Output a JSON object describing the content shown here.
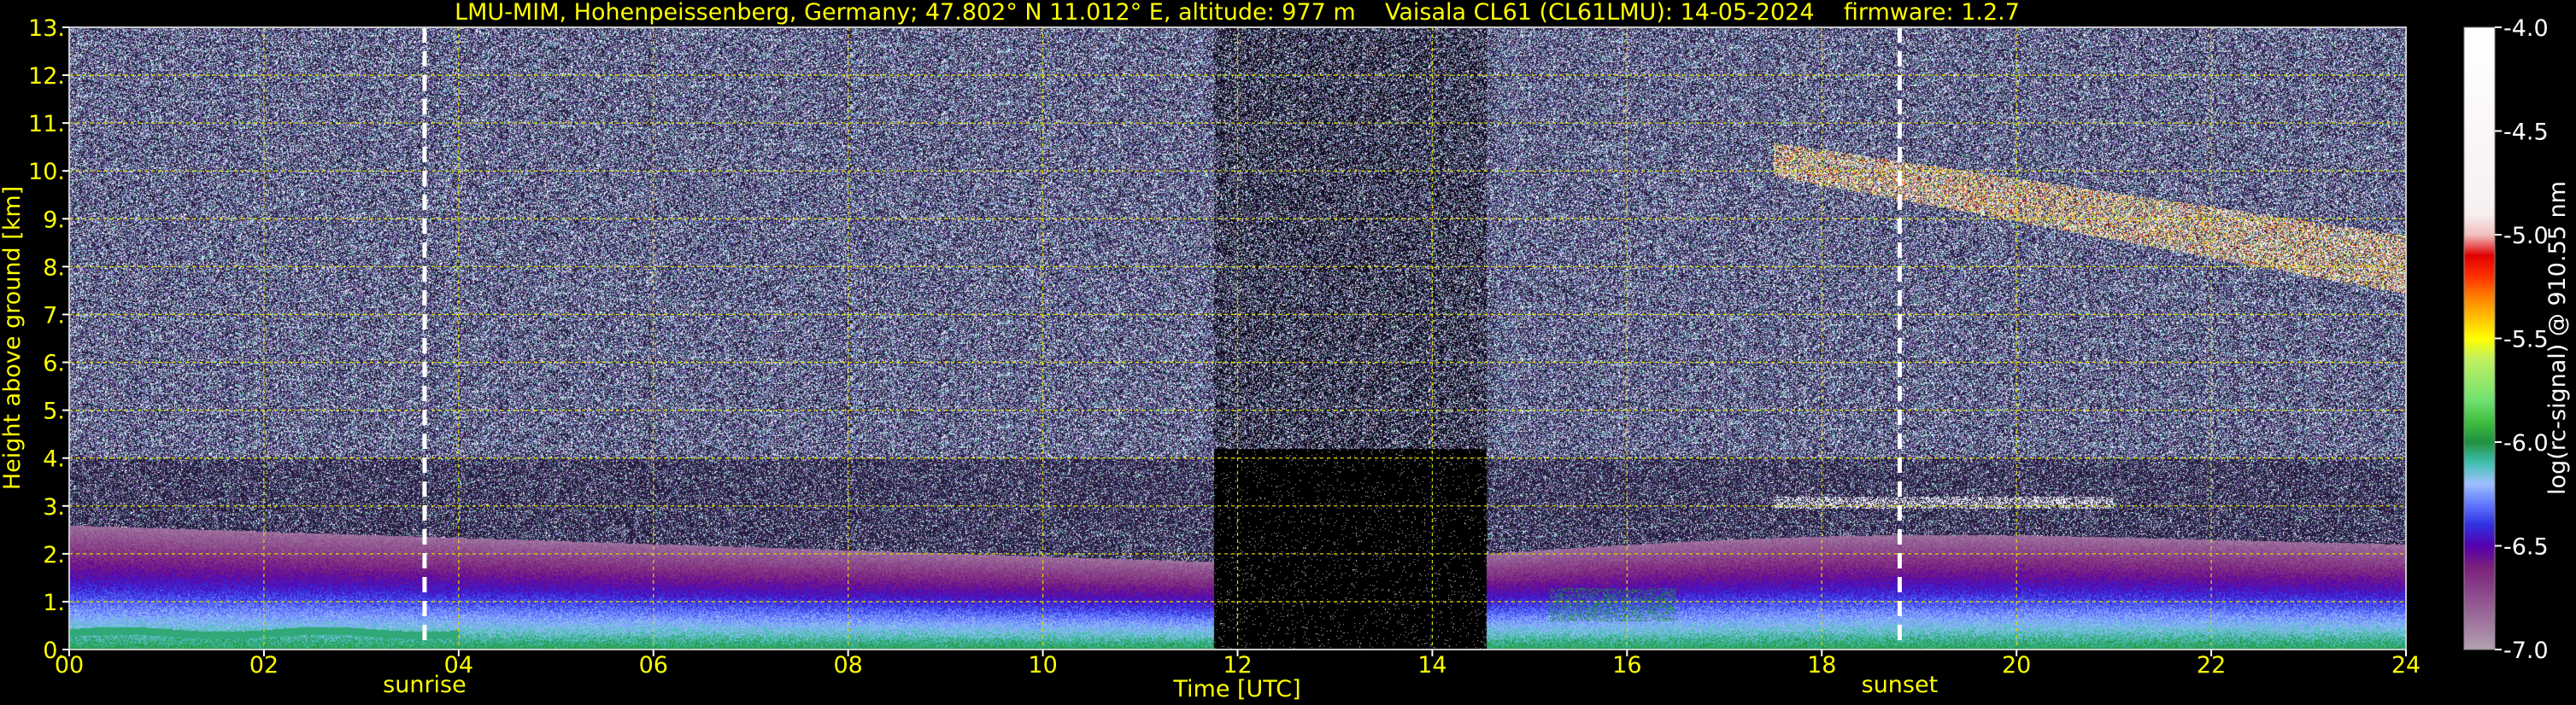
{
  "title": "LMU-MIM, Hohenpeissenberg, Germany; 47.802° N 11.012° E, altitude: 977 m    Vaisala CL61 (CL61LMU): 14-05-2024    firmware: 1.2.7",
  "colors": {
    "background": "#000000",
    "text": "#ffff00",
    "grid": "#d8d800",
    "markers": "#ffffff"
  },
  "chart_data": {
    "type": "heatmap",
    "title": "LMU-MIM, Hohenpeissenberg, Germany; 47.802° N 11.012° E, altitude: 977 m    Vaisala CL61 (CL61LMU): 14-05-2024    firmware: 1.2.7",
    "xlabel": "Time [UTC]",
    "ylabel": "Height above ground [km]",
    "xlim": [
      0,
      24
    ],
    "ylim": [
      0,
      13
    ],
    "x_ticks": [
      0,
      2,
      4,
      6,
      8,
      10,
      12,
      14,
      16,
      18,
      20,
      22,
      24
    ],
    "x_tick_labels": [
      "00",
      "02",
      "04",
      "06",
      "08",
      "10",
      "12",
      "14",
      "16",
      "18",
      "20",
      "22",
      "24"
    ],
    "y_ticks": [
      0,
      1,
      2,
      3,
      4,
      5,
      6,
      7,
      8,
      9,
      10,
      11,
      12,
      13
    ],
    "y_tick_labels": [
      "0.",
      "1.",
      "2.",
      "3.",
      "4.",
      "5.",
      "6.",
      "7.",
      "8.",
      "9.",
      "10.",
      "11.",
      "12.",
      "13."
    ],
    "grid": true,
    "vertical_markers": [
      {
        "label": "sunrise",
        "x": 3.65
      },
      {
        "label": "sunset",
        "x": 18.8
      }
    ],
    "colorbar": {
      "label": "log(rc-signal) @ 910.55 nm",
      "range": [
        -7.0,
        -4.0
      ],
      "ticks": [
        -4.0,
        -4.5,
        -5.0,
        -5.5,
        -6.0,
        -6.5,
        -7.0
      ],
      "tick_labels": [
        "-4.0",
        "-4.5",
        "-5.0",
        "-5.5",
        "-6.0",
        "-6.5",
        "-7.0"
      ],
      "stops": [
        {
          "value": -7.0,
          "color": "#b3a1b3"
        },
        {
          "value": -6.8,
          "color": "#955f95"
        },
        {
          "value": -6.6,
          "color": "#7a1f7a"
        },
        {
          "value": -6.5,
          "color": "#5500b0"
        },
        {
          "value": -6.4,
          "color": "#3030e0"
        },
        {
          "value": -6.3,
          "color": "#6078ff"
        },
        {
          "value": -6.2,
          "color": "#9fc0ff"
        },
        {
          "value": -6.1,
          "color": "#40c0b0"
        },
        {
          "value": -6.0,
          "color": "#209040"
        },
        {
          "value": -5.9,
          "color": "#40c040"
        },
        {
          "value": -5.8,
          "color": "#70e070"
        },
        {
          "value": -5.6,
          "color": "#c0f060"
        },
        {
          "value": -5.5,
          "color": "#ffff00"
        },
        {
          "value": -5.4,
          "color": "#ffc000"
        },
        {
          "value": -5.3,
          "color": "#ff8000"
        },
        {
          "value": -5.2,
          "color": "#ff3000"
        },
        {
          "value": -5.1,
          "color": "#e00000"
        },
        {
          "value": -5.0,
          "color": "#f0c0c0"
        },
        {
          "value": -4.9,
          "color": "#f8f0f0"
        },
        {
          "value": -4.0,
          "color": "#ffffff"
        }
      ]
    },
    "data_gap": {
      "start": 11.75,
      "end": 14.55
    },
    "features": [
      {
        "name": "boundary layer",
        "x_range": [
          0,
          24
        ],
        "height_km": [
          0,
          2.6
        ],
        "log_signal": -6.3
      },
      {
        "name": "upper cirrus",
        "x_range": [
          17.5,
          24
        ],
        "height_km": [
          7.0,
          10.5
        ],
        "log_signal": -4.8
      },
      {
        "name": "low cloud",
        "x_range": [
          17.5,
          21.0
        ],
        "height_km": [
          2.9,
          3.3
        ],
        "log_signal": -4.5
      }
    ]
  }
}
